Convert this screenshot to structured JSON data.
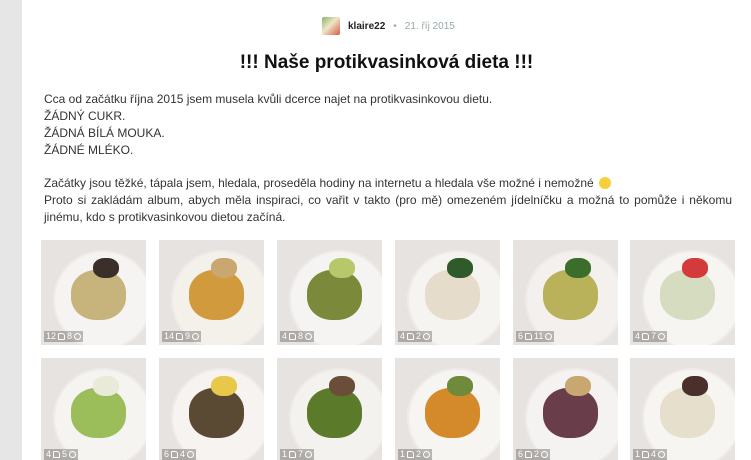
{
  "post": {
    "author": "klaire22",
    "date": "21. říj 2015",
    "title": "!!! Naše protikvasinková dieta !!!",
    "paragraph1": [
      "Cca od začátku října 2015 jsem musela kvůli dcerce najet na protikvasinkovou dietu.",
      "ŽÁDNÝ CUKR.",
      "ŽÁDNÁ BÍLÁ MOUKA.",
      "ŽÁDNÉ MLÉKO."
    ],
    "paragraph2_line1": "Začátky jsou těžké, tápala jsem, hledala, proseděla hodiny na internetu a hledala vše možné i nemožné",
    "paragraph2_line2": "Proto si zakládám album, abych měla inspiraci, co vařit v takto (pro mě) omezeném jídelníčku a možná to pomůže i někomu jinému, kdo s protikvasinkovou dietou začíná."
  },
  "photos": [
    {
      "likes": "12",
      "comments": "8",
      "icon": "thumb-icon",
      "plate": "#f6f4f2",
      "food": "#c7b37c",
      "accent": "#3a2f2a"
    },
    {
      "likes": "14",
      "comments": "9",
      "icon": "thumb-icon",
      "plate": "#f4f0ea",
      "food": "#d09a3d",
      "accent": "#c8a770"
    },
    {
      "likes": "4",
      "comments": "8",
      "icon": "thumb-icon",
      "plate": "#f5f4f3",
      "food": "#7a8a3a",
      "accent": "#b6c86a"
    },
    {
      "likes": "4",
      "comments": "2",
      "icon": "thumb-icon",
      "plate": "#f6f4f1",
      "food": "#e6dccb",
      "accent": "#2f5a2a"
    },
    {
      "likes": "6",
      "comments": "11",
      "icon": "thumb-icon",
      "plate": "#f3f0ed",
      "food": "#b9b25a",
      "accent": "#3b6e2a"
    },
    {
      "likes": "4",
      "comments": "7",
      "icon": "thumb-icon",
      "plate": "#f7f5f2",
      "food": "#d6dcc0",
      "accent": "#d43a3a"
    },
    {
      "likes": "4",
      "comments": "5",
      "icon": "thumb-icon",
      "plate": "#f5f4f1",
      "food": "#9bbd5a",
      "accent": "#e9ead8"
    },
    {
      "likes": "6",
      "comments": "4",
      "icon": "thumb-icon",
      "plate": "#f6f3f0",
      "food": "#5b4a33",
      "accent": "#e8c84a"
    },
    {
      "likes": "1",
      "comments": "7",
      "icon": "thumb-icon",
      "plate": "#f4f2ef",
      "food": "#5b7a2a",
      "accent": "#6b4e3a"
    },
    {
      "likes": "1",
      "comments": "2",
      "icon": "thumb-icon",
      "plate": "#f6f5f2",
      "food": "#d48a2a",
      "accent": "#6e8a3a"
    },
    {
      "likes": "6",
      "comments": "2",
      "icon": "thumb-icon",
      "plate": "#f5f3f1",
      "food": "#6a3d4a",
      "accent": "#c9a770"
    },
    {
      "likes": "1",
      "comments": "4",
      "icon": "thumb-icon",
      "plate": "#f7f5f2",
      "food": "#e6dfcc",
      "accent": "#4a2f2a"
    }
  ]
}
